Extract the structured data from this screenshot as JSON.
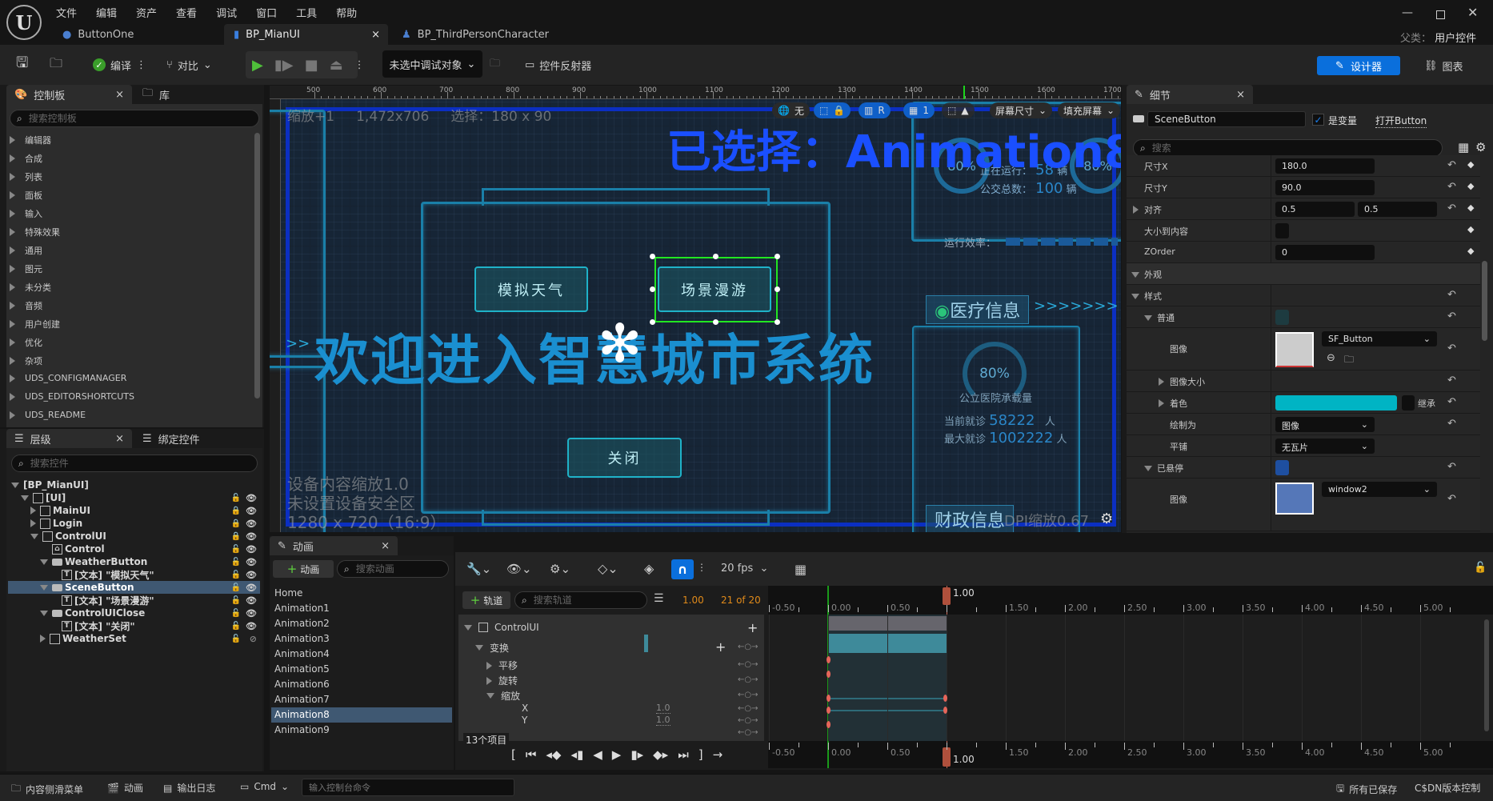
{
  "menu": [
    "文件",
    "编辑",
    "资产",
    "查看",
    "调试",
    "窗口",
    "工具",
    "帮助"
  ],
  "tabs": [
    {
      "label": "ButtonOne",
      "icon": "pawn-icon"
    },
    {
      "label": "BP_MianUI",
      "icon": "widget-blueprint-icon",
      "active": true
    },
    {
      "label": "BP_ThirdPersonCharacter",
      "icon": "character-icon"
    }
  ],
  "window": {
    "parent_label": "父类：",
    "parent_value": "用户控件"
  },
  "toolbar": {
    "compile": "编译",
    "diff": "对比",
    "debug_target": "未选中调试对象",
    "widget_reflector": "控件反射器",
    "designer": "设计器",
    "graph": "图表"
  },
  "palette": {
    "tab": "控制板",
    "library_tab": "库",
    "search_placeholder": "搜索控制板",
    "items": [
      "编辑器",
      "合成",
      "列表",
      "面板",
      "输入",
      "特殊效果",
      "通用",
      "图元",
      "未分类",
      "音频",
      "用户创建",
      "优化",
      "杂项",
      "UDS_CONFIGMANAGER",
      "UDS_EDITORSHORTCUTS",
      "UDS_README"
    ]
  },
  "hierarchy": {
    "tab": "层级",
    "bind_tab": "绑定控件",
    "search_placeholder": "搜索控件",
    "rows": [
      {
        "label": "[BP_MianUI]",
        "depth": 0,
        "expand": "down",
        "icon": "",
        "lock": "",
        "eye": ""
      },
      {
        "label": "[UI]",
        "depth": 1,
        "expand": "down",
        "icon": "panel",
        "lock": "unlocked",
        "eye": "visible"
      },
      {
        "label": "MainUI",
        "depth": 2,
        "expand": "right",
        "icon": "panel",
        "lock": "locked",
        "eye": "visible"
      },
      {
        "label": "Login",
        "depth": 2,
        "expand": "right",
        "icon": "panel",
        "lock": "locked",
        "eye": "visible"
      },
      {
        "label": "ControlUI",
        "depth": 2,
        "expand": "down",
        "icon": "panel",
        "lock": "locked",
        "eye": "visible"
      },
      {
        "label": "Control",
        "depth": 3,
        "expand": "",
        "icon": "image",
        "lock": "unlocked",
        "eye": "visible"
      },
      {
        "label": "WeatherButton",
        "depth": 3,
        "expand": "down",
        "icon": "button",
        "lock": "unlocked",
        "eye": "visible"
      },
      {
        "label": "[文本] \"模拟天气\"",
        "depth": 4,
        "expand": "",
        "icon": "text",
        "lock": "unlocked",
        "eye": "visible"
      },
      {
        "label": "SceneButton",
        "depth": 3,
        "expand": "down",
        "icon": "button",
        "lock": "unlocked",
        "eye": "visible",
        "selected": true
      },
      {
        "label": "[文本] \"场景漫游\"",
        "depth": 4,
        "expand": "",
        "icon": "text",
        "lock": "unlocked",
        "eye": "visible"
      },
      {
        "label": "ControlUIClose",
        "depth": 3,
        "expand": "down",
        "icon": "button",
        "lock": "unlocked",
        "eye": "visible"
      },
      {
        "label": "[文本] \"关闭\"",
        "depth": 4,
        "expand": "",
        "icon": "text",
        "lock": "unlocked",
        "eye": "visible"
      },
      {
        "label": "WeatherSet",
        "depth": 3,
        "expand": "right",
        "icon": "panel",
        "lock": "unlocked",
        "eye": "hidden"
      }
    ]
  },
  "viewport": {
    "ruler": [
      "500",
      "600",
      "700",
      "800",
      "900",
      "1000",
      "1100",
      "1200",
      "1300",
      "1400",
      "1500",
      "1600",
      "1700"
    ],
    "zoom": "缩放+1",
    "resolution": "1,472x706",
    "selection": "选择：180 x 90",
    "selected_anim": "已选择：Animation8",
    "toolbar": {
      "none": "无",
      "r": "R",
      "grid": "1",
      "screen_size": "屏幕尺寸",
      "fill_screen": "填充屏幕"
    },
    "title": "欢迎进入智慧城市系统",
    "buttons": {
      "weather": "模拟天气",
      "scene": "场景漫游",
      "close": "关闭"
    },
    "right": {
      "running_label": "正在运行：",
      "running": "58",
      "unit_car": "辆",
      "bus_label": "公交总数：",
      "bus": "100",
      "pct": "80%",
      "efficiency": "运行效率：",
      "medical": "医疗信息",
      "hospital": "公立医院承载量",
      "cur_label": "当前就诊",
      "cur": "58222",
      "max_label": "最大就诊",
      "max": "1002222",
      "unit_person": "人",
      "finance": "财政信息",
      "pct2": "80%"
    },
    "device_scale": "设备内容缩放1.0",
    "safe_zone": "未设置设备安全区",
    "device_res": "1280 x 720（16:9）",
    "dpi": "DPI缩放0.67"
  },
  "details": {
    "tab": "细节",
    "name": "SceneButton",
    "is_variable": "是变量",
    "is_variable_checked": true,
    "open": "打开Button",
    "search_placeholder": "搜索",
    "size_x_label": "尺寸X",
    "size_x": "180.0",
    "size_y_label": "尺寸Y",
    "size_y": "90.0",
    "align_label": "对齐",
    "align_x": "0.5",
    "align_y": "0.5",
    "size_to_content": "大小到内容",
    "zorder_label": "ZOrder",
    "zorder": "0",
    "appearance": "外观",
    "style": "样式",
    "normal": "普通",
    "image": "图像",
    "image_value": "SF_Button",
    "image_size": "图像大小",
    "tint": "着色",
    "tint_color": "#00b4c4",
    "inherit": "继承",
    "draw_as": "绘制为",
    "draw_as_value": "图像",
    "tiling": "平铺",
    "tiling_value": "无瓦片",
    "hovered": "已悬停",
    "hovered_image": "window2"
  },
  "animations": {
    "tab": "动画",
    "add": "动画",
    "search_placeholder": "搜索动画",
    "items": [
      "Home",
      "Animation1",
      "Animation2",
      "Animation3",
      "Animation4",
      "Animation5",
      "Animation6",
      "Animation7",
      "Animation8",
      "Animation9"
    ],
    "selected": 8
  },
  "sequencer": {
    "fps": "20 fps",
    "add_track": "轨道",
    "search_placeholder": "搜索轨道",
    "time": "1.00",
    "frame": "21 of 20",
    "tracks": [
      {
        "label": "ControlUI",
        "level": 0
      },
      {
        "label": "变换",
        "level": 1
      },
      {
        "label": "平移",
        "level": 2
      },
      {
        "label": "旋转",
        "level": 2
      },
      {
        "label": "缩放",
        "level": 2
      },
      {
        "label": "X",
        "level": 3,
        "value": "1.0"
      },
      {
        "label": "Y",
        "level": 3,
        "value": "1.0"
      }
    ],
    "item_count": "13个项目",
    "ticks": [
      "-0.50",
      "0.00",
      "0.50",
      "1.00",
      "1.50",
      "2.00",
      "2.50",
      "3.00",
      "3.50",
      "4.00",
      "4.50",
      "5.00"
    ],
    "playhead": "1.00"
  },
  "status": {
    "content_drawer": "内容侧滑菜单",
    "anim": "动画",
    "output_log": "输出日志",
    "cmd": "Cmd",
    "cmd_placeholder": "输入控制台命令",
    "saved": "所有已保存",
    "source_control": "C$DN版本控制"
  }
}
